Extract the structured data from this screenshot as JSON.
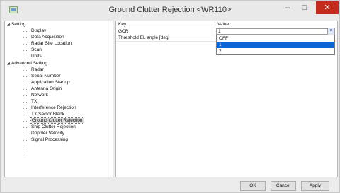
{
  "window": {
    "title": "Ground Clutter Rejection <WR110>",
    "minimize_glyph": "–",
    "maximize_glyph": "□",
    "close_glyph": "✕"
  },
  "tree": {
    "groups": [
      {
        "label": "Setting",
        "items": [
          "Display",
          "Data Acquisition",
          "Radar Site Location",
          "Scan",
          "Units"
        ]
      },
      {
        "label": "Advanced Setting",
        "items": [
          "Radar",
          "Serial Number",
          "Application Startup",
          "Antenna Origin",
          "Network",
          "TX",
          "Interference Rejection",
          "TX Sector Blank",
          "Ground Clutter Rejection",
          "Ship Clutter Rejection",
          "Doppler Velocity",
          "Signal Processing"
        ]
      }
    ],
    "selected": "Ground Clutter Rejection"
  },
  "grid": {
    "headers": {
      "key": "Key",
      "value": "Value"
    },
    "rows": [
      {
        "key": "GCR",
        "value": "1"
      },
      {
        "key": "Threshold EL angle [deg]",
        "value": ""
      }
    ],
    "dropdown": {
      "options": [
        "OFF",
        "1",
        "2"
      ],
      "highlighted_index": 1
    }
  },
  "buttons": {
    "ok": "OK",
    "cancel": "Cancel",
    "apply": "Apply"
  },
  "colors": {
    "highlight": "#0a64d6",
    "close_button": "#c42b1c"
  }
}
